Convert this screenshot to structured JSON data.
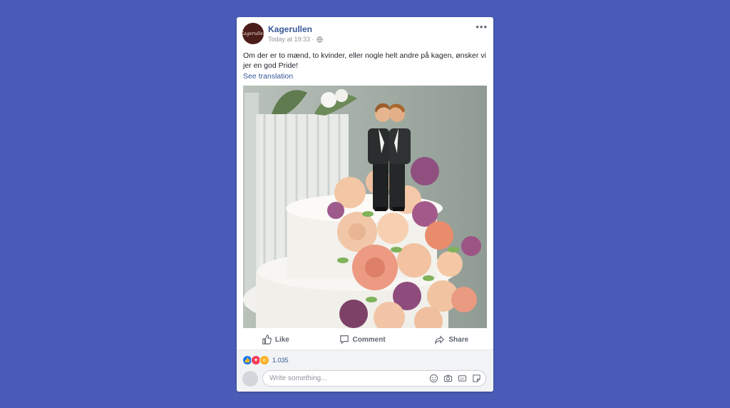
{
  "post": {
    "avatar_text": "Kagerullen",
    "page_name": "Kagerullen",
    "timestamp": "Today at 19:33 ·",
    "text": "Om der er to mænd, to kvinder, eller nogle helt andre på kagen, ønsker vi jer en god Pride!",
    "see_translation": "See translation",
    "photo_description": "Wedding cake with two grooms topper"
  },
  "actions": {
    "like": "Like",
    "comment": "Comment",
    "share": "Share"
  },
  "reactions": {
    "count": "1.035",
    "types": [
      "like-icon",
      "love-icon",
      "wow-icon"
    ]
  },
  "comment_box": {
    "placeholder": "Write something..."
  },
  "colors": {
    "background": "#4a5cb7",
    "link": "#385898",
    "like": "#1877f2",
    "love": "#f33e58",
    "wow": "#f7b125"
  }
}
